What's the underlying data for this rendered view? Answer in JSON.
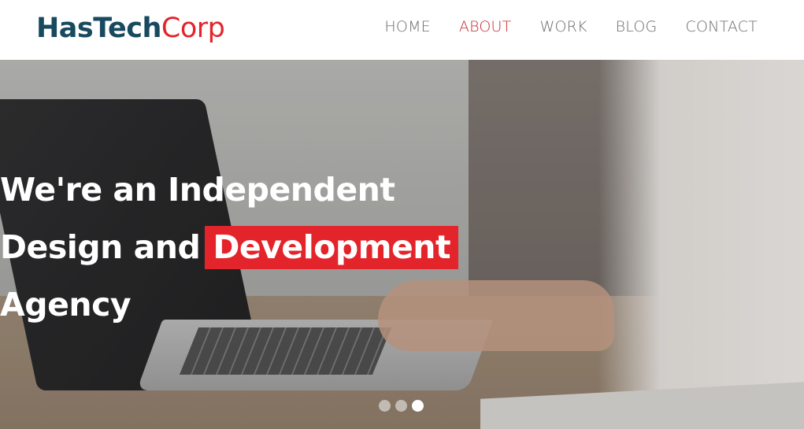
{
  "logo": {
    "part1": "HasTech",
    "part2": "Corp"
  },
  "nav": {
    "items": [
      "HOME",
      "ABOUT",
      "WORK",
      "BLOG",
      "CONTACT"
    ],
    "active": "ABOUT"
  },
  "hero": {
    "line1": "We're an Independent",
    "line2_plain": "Design and",
    "line2_highlight": "Development",
    "line3": "Agency"
  },
  "slider": {
    "count": 3,
    "active_index": 3
  },
  "colors": {
    "brand_dark": "#18495f",
    "brand_red": "#e3242b",
    "nav_active": "#c62a2f"
  }
}
